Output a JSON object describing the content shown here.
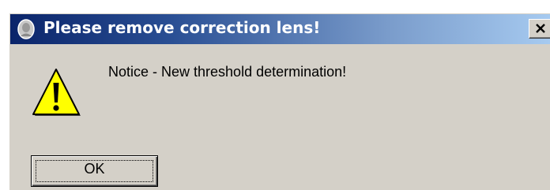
{
  "window": {
    "title": "Please remove correction lens!",
    "close_label": "X",
    "title_gradient": [
      "#0a246a",
      "#a6caf0"
    ],
    "background": "#d4d0c8"
  },
  "dialog": {
    "icon": "warning-icon",
    "message": "Notice - New threshold determination!",
    "ok_label": "OK"
  }
}
